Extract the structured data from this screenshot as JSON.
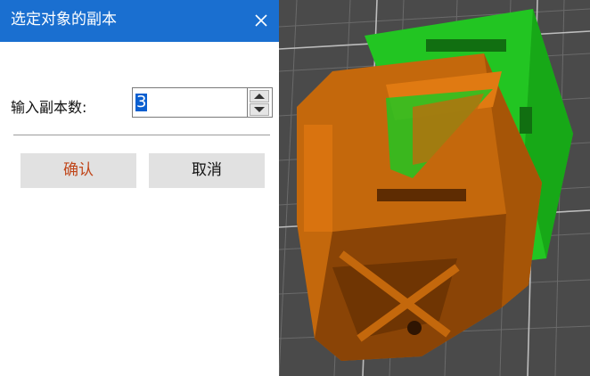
{
  "dialog": {
    "title": "选定对象的副本",
    "count_label": "输入副本数:",
    "count_value": "3",
    "ok_label": "确认",
    "cancel_label": "取消"
  },
  "colors": {
    "titlebar": "#1a6fd0",
    "ok_text": "#c0461a",
    "model_orange": "#c4680c",
    "model_green": "#22c522"
  }
}
